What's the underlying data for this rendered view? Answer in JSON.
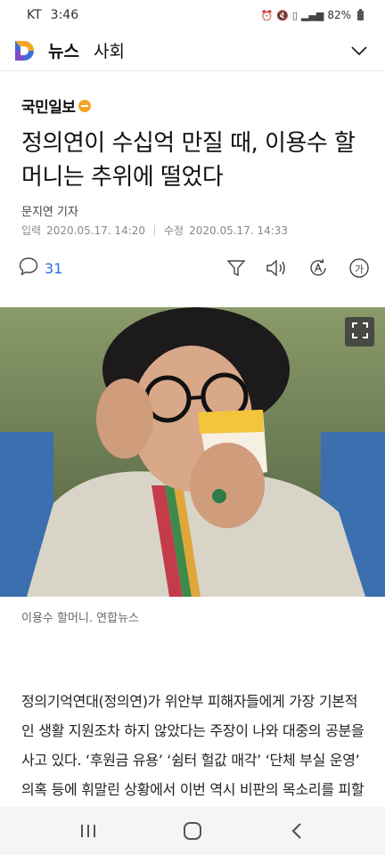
{
  "status_bar": {
    "carrier": "KT",
    "time": "3:46",
    "battery": "82%"
  },
  "app_bar": {
    "logo_icon": "daum-d-logo",
    "section": "뉴스",
    "category": "사회",
    "menu_icon": "chevron-down-icon"
  },
  "article": {
    "publisher": "국민일보",
    "headline": "정의연이 수십억 만질 때, 이용수 할머니는 추위에 떨었다",
    "reporter": "문지연 기자",
    "published_label": "입력",
    "published_at": "2020.05.17. 14:20",
    "modified_label": "수정",
    "modified_at": "2020.05.17. 14:33",
    "comment_count": "31",
    "photo_caption": "이용수 할머니. 연합뉴스",
    "body": "정의기억연대(정의연)가 위안부 피해자들에게 가장 기본적인 생활 지원조차 하지 않았다는 주장이 나와 대중의 공분을 사고 있다. ‘후원금 유용’ ‘쉼터 헐값 매각’ ‘단체 부실 운영’ 의혹 등에 휘말린 상황에서 이번 역시 비판의 목소리를 피할 수 없을 것으로 보인다."
  },
  "toolbar_icons": [
    "comment-icon",
    "filter-icon",
    "speaker-icon",
    "translate-icon",
    "font-size-icon"
  ],
  "font_size_glyph": "가",
  "colors": {
    "accent_blue": "#2a6fdb",
    "logo_orange": "#f5a623",
    "logo_blue": "#3e6fe0",
    "logo_purple": "#7e4ec9"
  }
}
